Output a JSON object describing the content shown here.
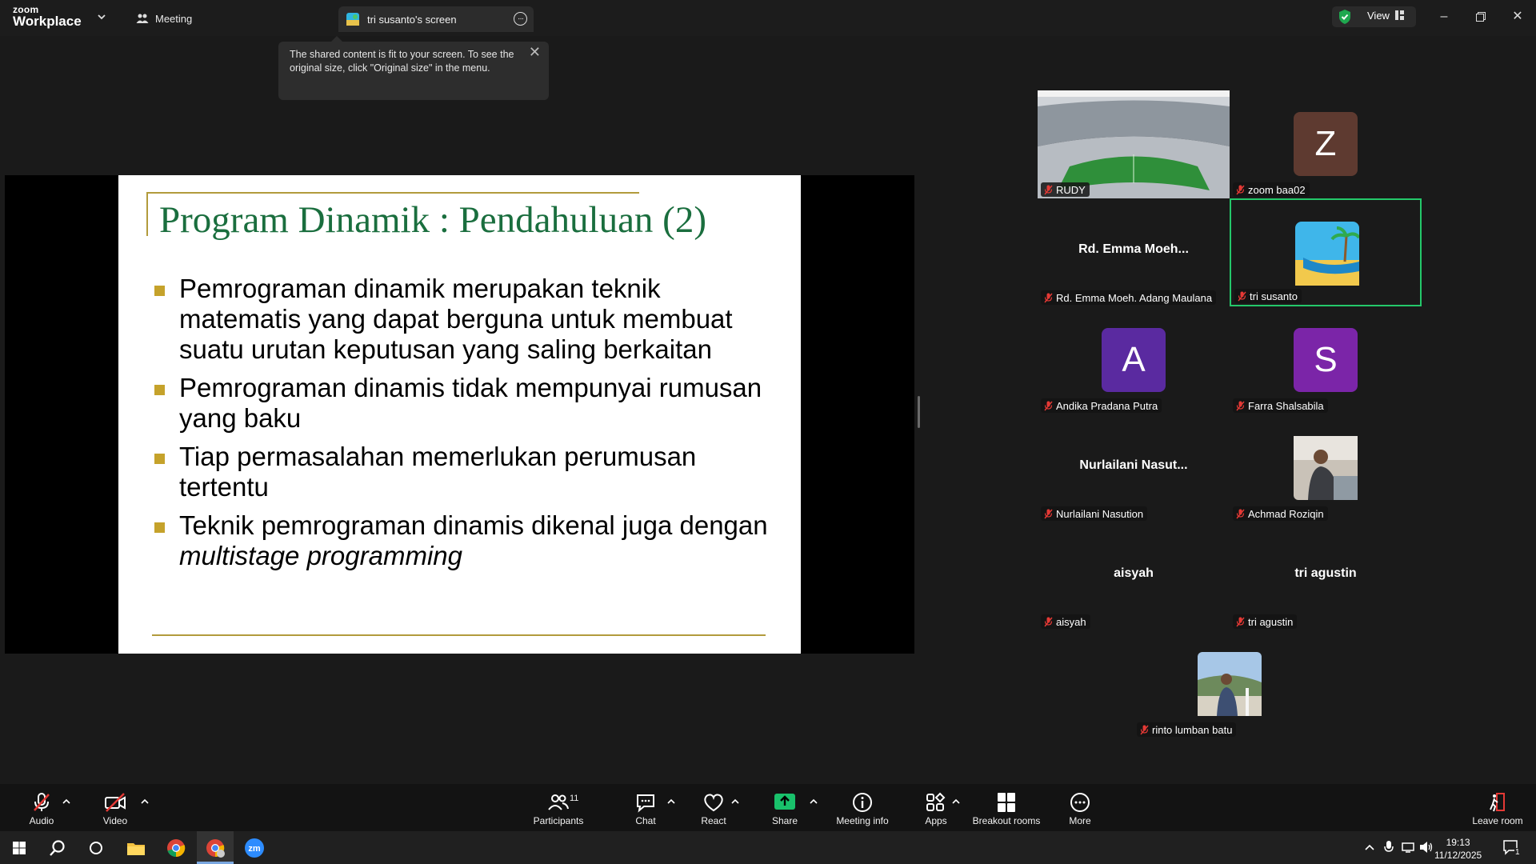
{
  "titlebar": {
    "logo_line1": "zoom",
    "logo_line2": "Workplace",
    "meeting_label": "Meeting",
    "screen_tab_label": "tri susanto's screen",
    "view_label": "View"
  },
  "tooltip": {
    "text": "The shared content is fit to your screen. To see the original size, click \"Original size\" in the menu."
  },
  "slide": {
    "title": "Program Dinamik : Pendahuluan (2)",
    "bullets": [
      "Pemrograman dinamik merupakan teknik matematis yang dapat berguna untuk membuat suatu urutan keputusan yang saling berkaitan",
      "Pemrograman dinamis tidak mempunyai rumusan yang baku",
      "Tiap permasalahan memerlukan perumusan tertentu"
    ],
    "bullet4_prefix": "Teknik pemrograman dinamis dikenal juga dengan ",
    "bullet4_italic": "multistage programming"
  },
  "participants": [
    {
      "name": "RUDY",
      "kind": "photo-stadium"
    },
    {
      "name": "zoom baa02",
      "kind": "letter",
      "letter": "Z",
      "color": "#5e3a30"
    },
    {
      "name": "Rd. Emma Moeh. Adang Maulana",
      "display": "Rd. Emma Moeh...",
      "kind": "text"
    },
    {
      "name": "tri susanto",
      "kind": "photo-beach",
      "active": true
    },
    {
      "name": "Andika Pradana Putra",
      "kind": "letter",
      "letter": "A",
      "color": "#5a2aa0"
    },
    {
      "name": "Farra Shalsabila",
      "kind": "letter",
      "letter": "S",
      "color": "#7b25a8"
    },
    {
      "name": "Nurlailani Nasution",
      "display": "Nurlailani Nasut...",
      "kind": "text"
    },
    {
      "name": "Achmad Roziqin",
      "kind": "photo-person"
    },
    {
      "name": "aisyah",
      "display": "aisyah",
      "kind": "text"
    },
    {
      "name": "tri agustin",
      "display": "tri agustin",
      "kind": "text"
    },
    {
      "name": "rinto lumban batu",
      "kind": "photo-outdoor"
    }
  ],
  "toolbar": {
    "audio": "Audio",
    "video": "Video",
    "participants": "Participants",
    "participants_count": "11",
    "chat": "Chat",
    "react": "React",
    "share": "Share",
    "meeting_info": "Meeting info",
    "apps": "Apps",
    "breakout": "Breakout rooms",
    "more": "More",
    "leave": "Leave room"
  },
  "taskbar": {
    "time": "19:13",
    "date": "11/12/2025",
    "notification_count": "1"
  },
  "colors": {
    "accent_green": "#24c86a",
    "slide_title": "#1a6e3e",
    "slide_bullet": "#c5a22b",
    "share_green": "#19c16b"
  }
}
